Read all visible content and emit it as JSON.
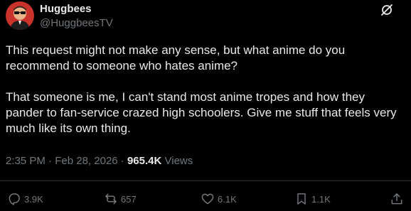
{
  "author": {
    "name": "Huggbees",
    "handle": "@HuggbeesTV",
    "avatar_icon": "avatar-man-sunglasses"
  },
  "post": {
    "paragraphs": [
      "This request might not make any sense, but what anime do you recommend to someone who hates anime?",
      "That someone is me, I can't stand most anime tropes and how they pander to fan-service crazed high schoolers. Give me stuff that feels very much like its own thing."
    ],
    "time": "2:35 PM",
    "separator": "·",
    "date": "Feb 28, 2026",
    "views_count": "965.4K",
    "views_label": "Views"
  },
  "actions": {
    "replies": "3.9K",
    "reposts": "657",
    "likes": "6.1K",
    "bookmarks": "1.1K"
  },
  "icons": {
    "grok": "grok-icon",
    "reply": "reply-icon",
    "repost": "repost-icon",
    "like": "heart-icon",
    "bookmark": "bookmark-icon",
    "share": "share-icon"
  },
  "colors": {
    "background": "#000000",
    "text": "#e7e9ea",
    "muted": "#71767b",
    "divider": "#2f3336"
  }
}
